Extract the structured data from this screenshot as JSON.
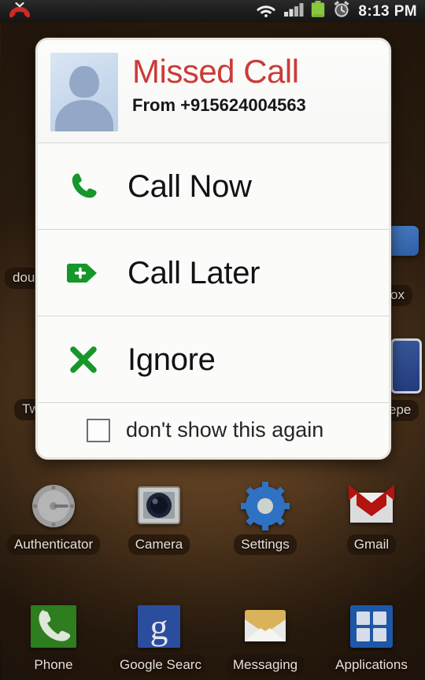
{
  "status_bar": {
    "missed_call_icon": "missed-call-handset-icon",
    "wifi_icon": "wifi-icon",
    "signal_icon": "cellular-signal-icon",
    "battery_icon": "battery-icon",
    "alarm_icon": "alarm-clock-icon",
    "time": "8:13 PM",
    "battery_color": "#8cc63e"
  },
  "dialog": {
    "title": "Missed Call",
    "title_color": "#cb3b36",
    "subtitle": "From +915624004563",
    "avatar_icon": "contact-avatar-placeholder-icon",
    "actions": [
      {
        "label": "Call Now",
        "icon": "phone-handset-icon",
        "color": "#17962a"
      },
      {
        "label": "Call Later",
        "icon": "tag-plus-icon",
        "color": "#17962a"
      },
      {
        "label": "Ignore",
        "icon": "cross-x-icon",
        "color": "#17962a"
      }
    ],
    "footer": {
      "checkbox_label": "don't show this again",
      "checked": false
    }
  },
  "home_screen": {
    "apps_row": [
      {
        "label": "Authenticator",
        "icon": "authenticator-icon"
      },
      {
        "label": "Camera",
        "icon": "camera-icon"
      },
      {
        "label": "Settings",
        "icon": "settings-gear-icon"
      },
      {
        "label": "Gmail",
        "icon": "gmail-icon"
      }
    ],
    "dock_row": [
      {
        "label": "Phone",
        "icon": "phone-icon"
      },
      {
        "label": "Google Searc",
        "icon": "google-search-icon"
      },
      {
        "label": "Messaging",
        "icon": "messaging-envelope-icon"
      },
      {
        "label": "Applications",
        "icon": "applications-grid-icon"
      }
    ],
    "occluded_labels": [
      {
        "text": "dou"
      },
      {
        "text": "ox"
      },
      {
        "text": "Tw"
      },
      {
        "text": "epe"
      }
    ]
  }
}
